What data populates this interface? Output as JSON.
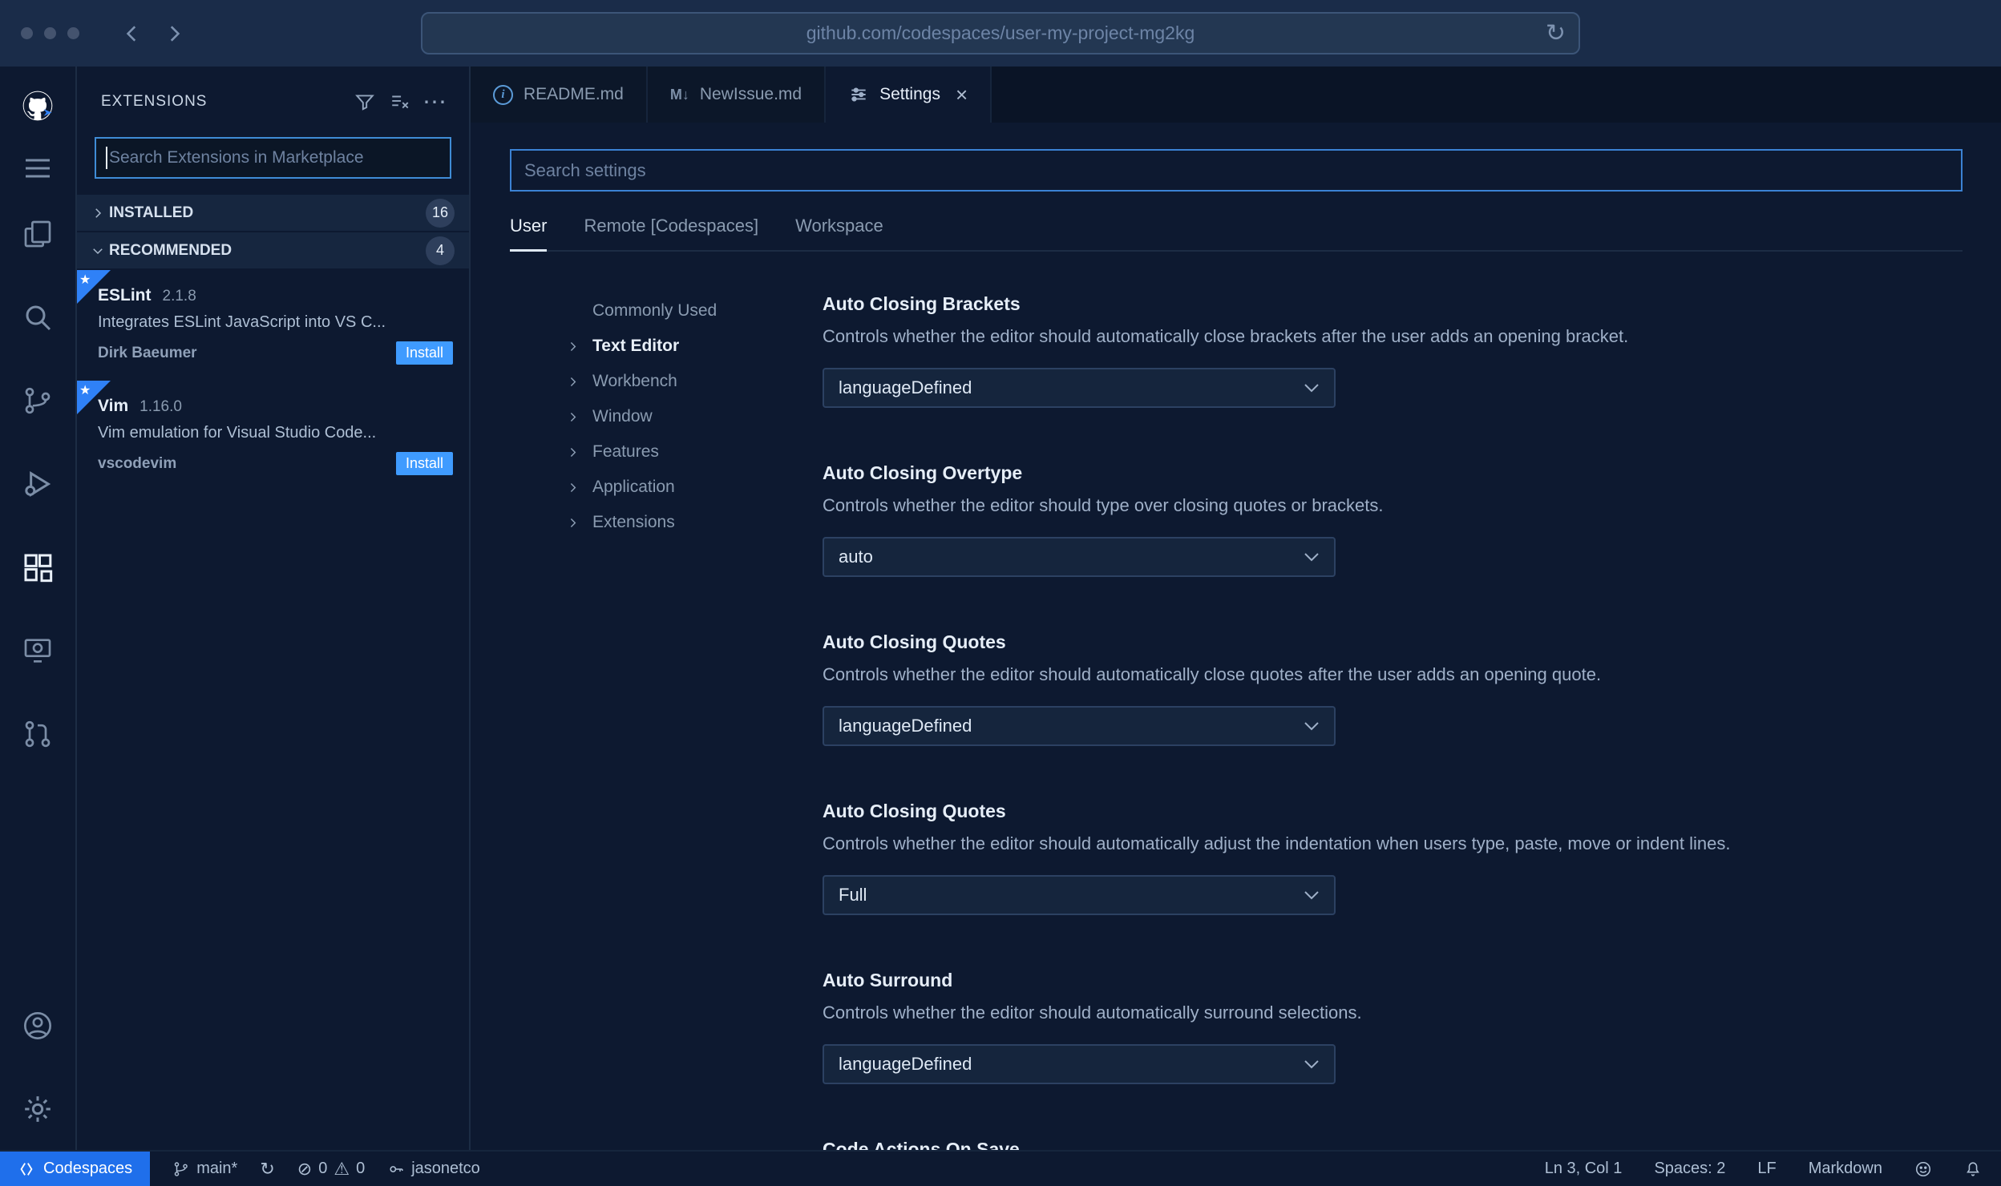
{
  "browser": {
    "url": "github.com/codespaces/user-my-project-mg2kg"
  },
  "sidebar": {
    "title": "EXTENSIONS",
    "search_placeholder": "Search Extensions in Marketplace",
    "sections": [
      {
        "label": "INSTALLED",
        "count": "16"
      },
      {
        "label": "RECOMMENDED",
        "count": "4"
      }
    ],
    "extensions": [
      {
        "name": "ESLint",
        "version": "2.1.8",
        "description": "Integrates ESLint JavaScript into VS C...",
        "publisher": "Dirk Baeumer",
        "action_label": "Install"
      },
      {
        "name": "Vim",
        "version": "1.16.0",
        "description": "Vim emulation for Visual Studio Code...",
        "publisher": "vscodevim",
        "action_label": "Install"
      }
    ]
  },
  "editor_tabs": [
    {
      "label": "README.md",
      "icon": "info-icon"
    },
    {
      "label": "NewIssue.md",
      "icon": "markdown-icon",
      "icon_glyph": "M↓"
    },
    {
      "label": "Settings",
      "icon": "settings-sliders-icon",
      "close_glyph": "×"
    }
  ],
  "settings": {
    "search_placeholder": "Search settings",
    "scopes": [
      {
        "label": "User"
      },
      {
        "label": "Remote [Codespaces]"
      },
      {
        "label": "Workspace"
      }
    ],
    "toc": [
      "Commonly Used",
      "Text Editor",
      "Workbench",
      "Window",
      "Features",
      "Application",
      "Extensions"
    ],
    "items": [
      {
        "title": "Auto Closing Brackets",
        "description": "Controls whether the editor should automatically close brackets after the user adds an opening bracket.",
        "value": "languageDefined"
      },
      {
        "title": "Auto Closing Overtype",
        "description": "Controls whether the editor should type over closing quotes or brackets.",
        "value": "auto"
      },
      {
        "title": "Auto Closing Quotes",
        "description": "Controls whether the editor should automatically close quotes after the user adds an opening quote.",
        "value": "languageDefined"
      },
      {
        "title": "Auto Closing Quotes",
        "description": "Controls whether the editor should automatically adjust the indentation when users type, paste, move or indent lines.",
        "value": "Full"
      },
      {
        "title": "Auto Surround",
        "description": "Controls whether the editor should automatically surround selections.",
        "value": "languageDefined"
      },
      {
        "title": "Code Actions On Save"
      }
    ]
  },
  "status_bar": {
    "remote_label": "Codespaces",
    "branch": "main*",
    "sync_glyph": "↻",
    "errors_glyph": "⊘",
    "errors": "0",
    "warnings_glyph": "⚠",
    "warnings": "0",
    "user": "jasonetco",
    "right": [
      "Ln 3, Col 1",
      "Spaces: 2",
      "LF",
      "Markdown"
    ]
  },
  "colors": {
    "accent": "#3f9bff",
    "remote_chip": "#1f6feb",
    "install_button": "#3f9bff",
    "ribbon": "#2f81f7"
  }
}
